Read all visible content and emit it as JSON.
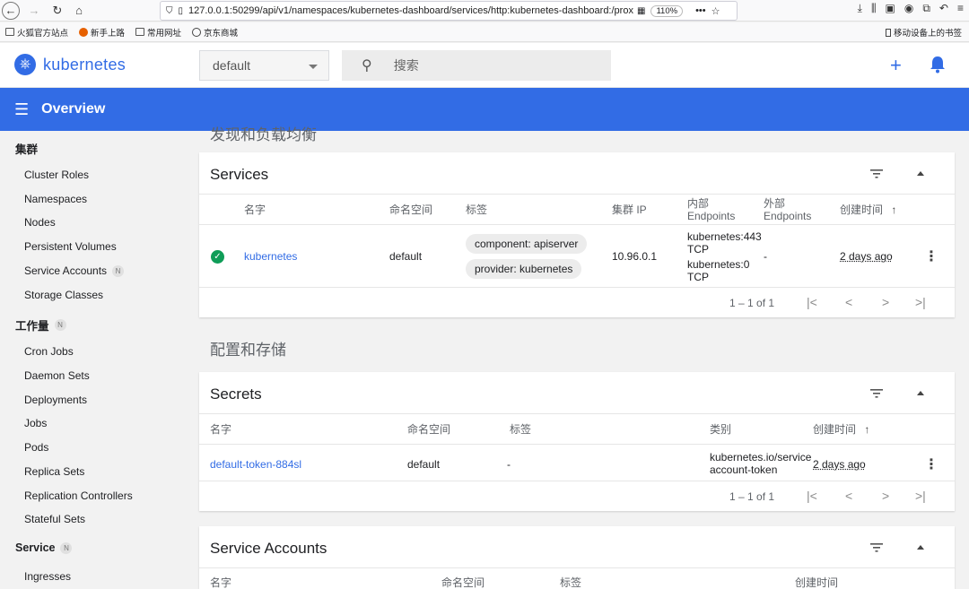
{
  "browser": {
    "url": "127.0.0.1:50299/api/v1/namespaces/kubernetes-dashboard/services/http:kubernetes-dashboard:/prox",
    "zoom": "110%",
    "bookmarks": [
      "火狐官方站点",
      "新手上路",
      "常用网址",
      "京东商城"
    ],
    "mobile_bookmarks": "移动设备上的书签"
  },
  "header": {
    "brand": "kubernetes",
    "namespace": "default",
    "search_placeholder": "搜索"
  },
  "toolbar": {
    "title": "Overview"
  },
  "sidebar": {
    "cluster_label": "集群",
    "cluster_items": [
      "Cluster Roles",
      "Namespaces",
      "Nodes",
      "Persistent Volumes",
      "Service Accounts",
      "Storage Classes"
    ],
    "workloads_label": "工作量",
    "workload_items": [
      "Cron Jobs",
      "Daemon Sets",
      "Deployments",
      "Jobs",
      "Pods",
      "Replica Sets",
      "Replication Controllers",
      "Stateful Sets"
    ],
    "service_label": "Service",
    "service_items": [
      "Ingresses"
    ],
    "badge": "N"
  },
  "top_section_partial": "发现和负载均衡",
  "services": {
    "title": "Services",
    "headers": {
      "name": "名字",
      "namespace": "命名空间",
      "labels": "标签",
      "cluster_ip": "集群 IP",
      "internal": "内部\nEndpoints",
      "external": "外部\nEndpoints",
      "created": "创建时间"
    },
    "rows": [
      {
        "name": "kubernetes",
        "namespace": "default",
        "labels": [
          "component: apiserver",
          "provider: kubernetes"
        ],
        "cluster_ip": "10.96.0.1",
        "internal": [
          "kubernetes:443 TCP",
          "kubernetes:0 TCP"
        ],
        "external": "-",
        "created": "2 days ago"
      }
    ],
    "pagination": "1 – 1 of 1"
  },
  "config_section": "配置和存储",
  "secrets": {
    "title": "Secrets",
    "headers": {
      "name": "名字",
      "namespace": "命名空间",
      "labels": "标签",
      "type": "类别",
      "created": "创建时间"
    },
    "rows": [
      {
        "name": "default-token-884sl",
        "namespace": "default",
        "labels": "-",
        "type": "kubernetes.io/service account-token",
        "created": "2 days ago"
      }
    ],
    "pagination": "1 – 1 of 1"
  },
  "service_accounts": {
    "title": "Service Accounts",
    "headers": {
      "name": "名字",
      "namespace": "命名空间",
      "labels": "标签",
      "created": "创建时间"
    }
  }
}
